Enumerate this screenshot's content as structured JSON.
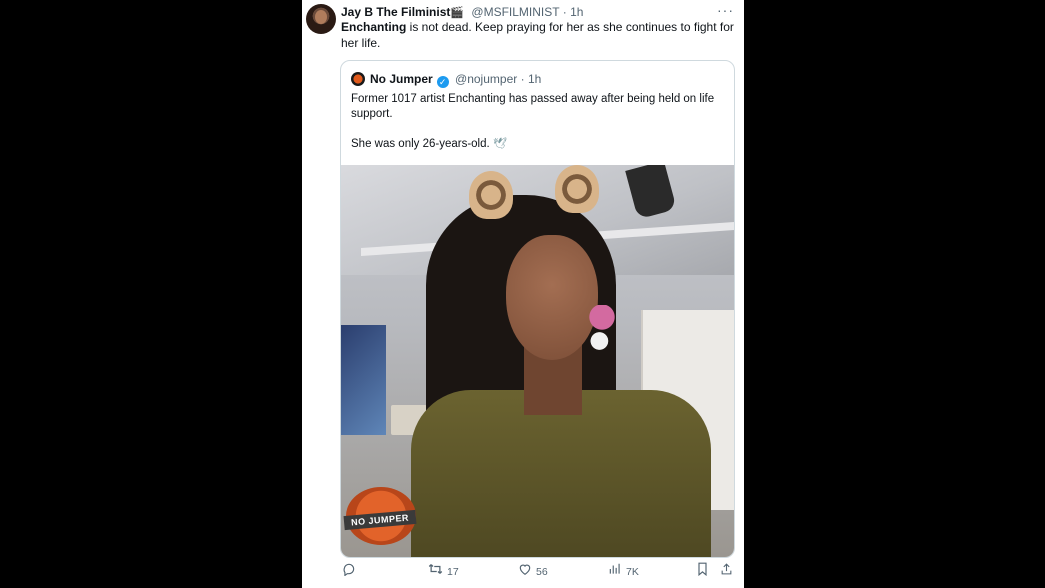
{
  "tweet": {
    "author_name": "Jay B The Filminist",
    "author_emoji": "🎬",
    "handle": "@MSFILMINIST",
    "separator": "·",
    "time": "1h",
    "more_label": "···",
    "text_bold": "Enchanting",
    "text_rest": " is not dead. Keep praying for her as she continues to fight for her life."
  },
  "quote": {
    "author_name": "No Jumper",
    "verified_mark": "✓",
    "handle": "@nojumper",
    "separator": "·",
    "time": "1h",
    "line1": "Former 1017 artist Enchanting has passed away after being held on life support.",
    "line2": "She was only 26-years-old.",
    "line2_emoji": "🕊",
    "image_watermark": "NO JUMPER"
  },
  "actions": {
    "reply_icon": "reply-icon",
    "reply_count": "",
    "retweet_count": "17",
    "like_count": "56",
    "views_count": "7K",
    "colors": {
      "icon": "#536471",
      "verified": "#1d9bf0",
      "border": "#cfd9de"
    }
  }
}
